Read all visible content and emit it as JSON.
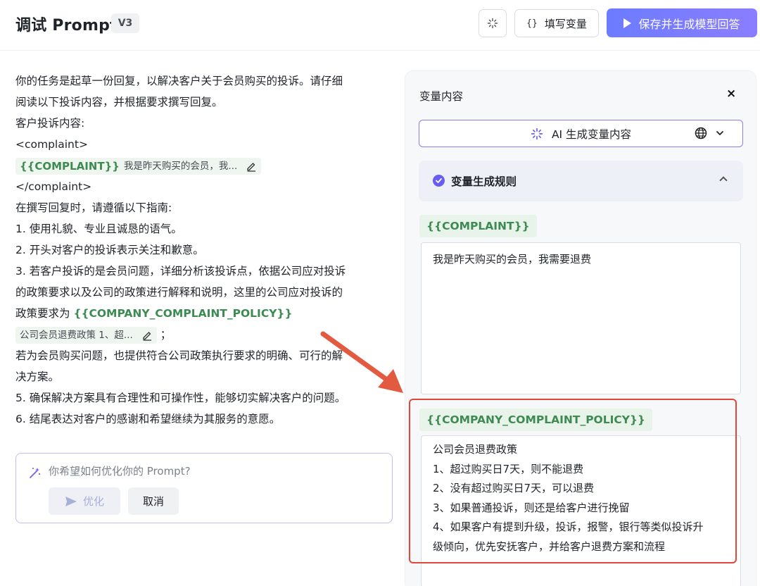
{
  "header": {
    "title": "调试 Prompt",
    "version": "V3",
    "fill_variables_label": "填写变量",
    "fill_variables_icon": "{}",
    "save_label": "保存并生成模型回答"
  },
  "prompt": {
    "lines": [
      "你的任务是起草一份回复，以解决客户关于会员购买的投诉。请仔细",
      "阅读以下投诉内容，并根据要求撰写回复。",
      "客户投诉内容:",
      "<complaint>",
      "</complaint>",
      "在撰写回复时，请遵循以下指南:",
      "1. 使用礼貌、专业且诚恳的语气。",
      "2. 开头对客户的投诉表示关注和歉意。",
      "3. 若客户投诉的是会员问题，详细分析该投诉点，依据公司应对投诉",
      "的政策要求以及公司的政策进行解释和说明，这里的公司应对投诉的",
      "政策要求为 ",
      "；",
      "若为会员购买问题，也提供符合公司政策执行要求的明确、可行的解",
      "决方案。",
      "5. 确保解决方案具有合理性和可操作性，能够切实解决客户的问题。",
      "6. 结尾表达对客户的感谢和希望继续为其服务的意愿。"
    ],
    "complaint_var": "{{COMPLAINT}}",
    "complaint_preview": "我是昨天购买的会员，我...",
    "policy_var": "{{COMPANY_COMPLAINT_POLICY}}",
    "policy_preview": "公司会员退费政策 1、超..."
  },
  "optimize": {
    "placeholder": "你希望如何优化你的 Prompt?",
    "optimize_label": "优化",
    "cancel_label": "取消"
  },
  "panel": {
    "title": "变量内容",
    "close": "×",
    "ai_button_label": "AI 生成变量内容",
    "rule_title": "变量生成规则",
    "complaint_var": "{{COMPLAINT}}",
    "complaint_value": "我是昨天购买的会员，我需要退费",
    "policy_var": "{{COMPANY_COMPLAINT_POLICY}}",
    "policy_lines": [
      "公司会员退费政策",
      "1、超过购买日7天，则不能退费",
      "2、没有超过购买日7天，可以退费",
      "3、如果普通投诉，则还是给客户进行挽留",
      "4、如果客户有提到升级，投诉，报警，银行等类似投诉升",
      "级倾向，优先安抚客户，并给客户退费方案和流程"
    ]
  },
  "colors": {
    "accent_purple": "#6c7cff",
    "variable_green": "#3d8b53",
    "highlight_red": "#e1473b"
  }
}
